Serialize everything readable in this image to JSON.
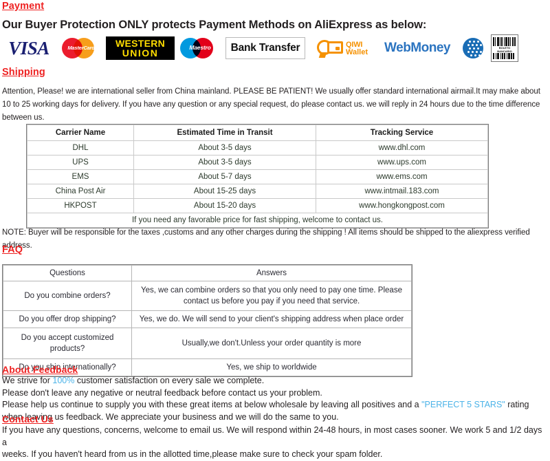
{
  "sections": {
    "payment": "Payment",
    "shipping": "Shipping",
    "faq": "FAQ",
    "about_feedback": "About Feedback",
    "contact_us": "Contact Us"
  },
  "payment": {
    "intro": "Our Buyer Protection ONLY protects Payment Methods on AliExpress as below:",
    "logos": [
      {
        "name": "visa-logo",
        "label": "VISA"
      },
      {
        "name": "mastercard-logo",
        "label": "MasterCard"
      },
      {
        "name": "western-union-logo",
        "line1": "WESTERN",
        "line2": "UNION"
      },
      {
        "name": "maestro-logo",
        "label": "Maestro"
      },
      {
        "name": "bank-transfer-logo",
        "label": "Bank Transfer"
      },
      {
        "name": "qiwi-wallet-logo",
        "line1": "QIWI",
        "line2": "Wallet"
      },
      {
        "name": "webmoney-logo",
        "label": "WebMoney"
      },
      {
        "name": "yandex-money-logo",
        "label": ""
      },
      {
        "name": "boleto-bancario-logo",
        "line1": "BOLETO",
        "line2": "BANCARIO"
      }
    ]
  },
  "shipping": {
    "paragraph": "Attention, Please! we are international seller from China mainland. PLEASE BE PATIENT! We usually offer standard international airmail.It may make about 10 to 25 working days for delivery. If you have any question or any special request, do please contact us. we will reply in 24 hours due to the time difference between us.",
    "table": {
      "headers": [
        "Carrier Name",
        "Estimated Time in Transit",
        "Tracking Service"
      ],
      "rows": [
        [
          "DHL",
          "About 3-5 days",
          "www.dhl.com"
        ],
        [
          "UPS",
          "About 3-5 days",
          "www.ups.com"
        ],
        [
          "EMS",
          "About 5-7 days",
          "www.ems.com"
        ],
        [
          "China Post Air",
          "About 15-25 days",
          "www.intmail.183.com"
        ],
        [
          "HKPOST",
          "About 15-20 days",
          "www.hongkongpost.com"
        ]
      ],
      "footer_note": "If you need any favorable price for fast shipping, welcome to contact us."
    },
    "note": "NOTE: Buyer will be responsible for the taxes ,customs and any other charges during the shipping ! All items should be shipped to the aliexpress verified address."
  },
  "faq": {
    "headers": [
      "Questions",
      "Answers"
    ],
    "rows": [
      {
        "question": "Do you combine orders?",
        "answer": "Yes, we can combine orders so that you only need to pay one time. Please contact us before you pay if you need that service.",
        "emphasis": false
      },
      {
        "question": "Do you offer drop shipping?",
        "answer": "Yes, we do. We will send to your client's shipping address when place order",
        "emphasis": false
      },
      {
        "question": "Do you accept customized products?",
        "answer": "Usually,we don't.Unless your order quantity is more",
        "emphasis": true
      },
      {
        "question": "Do you ship internationally?",
        "answer": "Yes, we ship to worldwide",
        "emphasis": false
      }
    ]
  },
  "feedback": {
    "line1_a": "We strive for ",
    "line1_hl": "100%",
    "line1_b": " customer satisfaction on every sale we complete.",
    "line2": "Please don't leave any negative or neutral feedback before contact us your problem.",
    "line3_a": "Please help us continue to supply you with these great items at below wholesale by leaving all positives and a ",
    "line3_hl": "\"PERFECT 5 STARS\"",
    "line3_b": " rating when leaving us feedback. We appreciate your business and we will do the same to you."
  },
  "contact": {
    "line1": "If you have any questions, concerns, welcome to email us. We will respond within 24-48 hours, in most cases sooner. We work 5 and 1/2 days a",
    "line2": "weeks. If you haven't heard from us in the allotted time,please make sure to check your spam folder."
  },
  "colors": {
    "heading_red": "#ee2222",
    "highlight_blue": "#4bb3e8",
    "table_text": "#2d3b2d"
  }
}
